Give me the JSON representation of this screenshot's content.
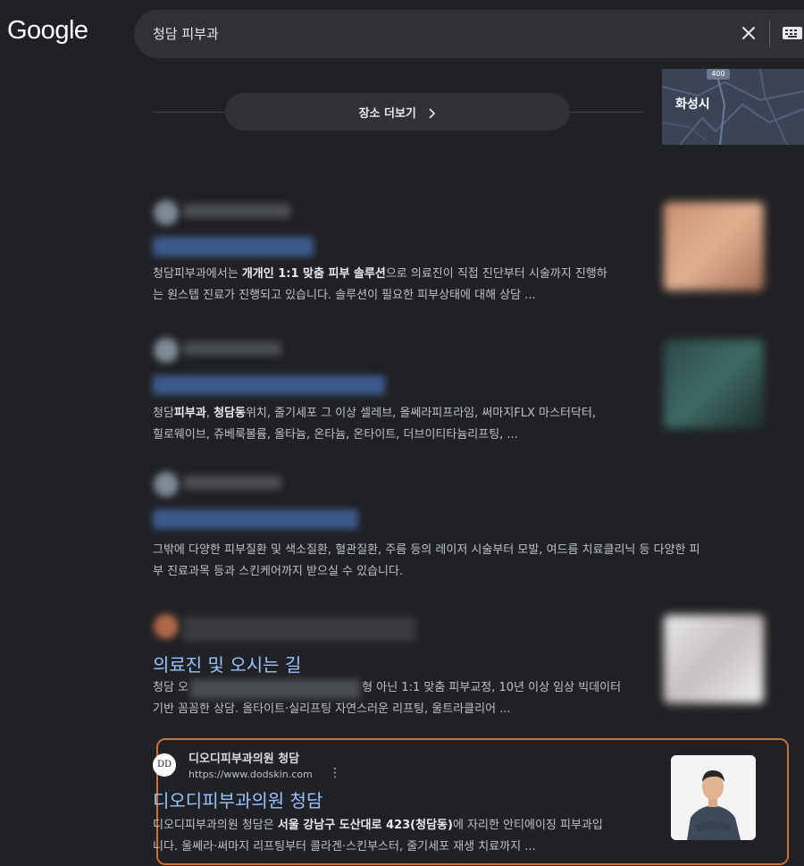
{
  "header": {
    "logo": "Google",
    "query": "청담 피부과",
    "clear_icon": "close-icon",
    "keyboard_icon": "keyboard-icon"
  },
  "places": {
    "more_label": "장소 더보기",
    "chevron_icon": "chevron-right-icon",
    "map_city": "화성시",
    "map_road": "400"
  },
  "results": [
    {
      "snippet_html": "청담피부과에서는 <b>개개인 1:1 맞춤 피부 솔루션</b>으로 의료진이 직접 진단부터 시술까지 진행하<br>는 원스텝 진료가 진행되고 있습니다. 솔루션이 필요한 피부상태에 대해 상담 ..."
    },
    {
      "snippet_html": "청담<b>피부과</b>, <b>청담동</b>위치, 줄기세포 그 이상 셀레브, 올쎄라피프라임, 써마지FLX 마스터닥터,<br>힐로웨이브, 쥬베룩볼륨, 올타늄, 온타늄, 온타이트, 더브이티타늄리프팅, ..."
    },
    {
      "snippet_html": "그밖에 다양한 피부질환 및 색소질환, 혈관질환, 주름 등의 레이저 시술부터 모발, 여드름 치료클리닉 등 다양한 피<br>부 진료과목 등과 스킨케어까지 받으실 수 있습니다."
    },
    {
      "title": "의료진 및 오시는 길",
      "snippet_html": "청담 오 <span style=\"display:inline-block;width:190px\"></span>형 아닌 1:1 맞춤 피부교정</b>, 10년 이상 임상 빅데이터<br>기반 꼼꼼한 상담. 올타이트·실리프팅 자연스러운 리프팅, 울트라클리어 ..."
    },
    {
      "site_name": "디오디피부과의원 청담",
      "url": "https://www.dodskin.com",
      "title": "디오디피부과의원 청담",
      "favicon_text": "DD",
      "more_icon": "more-vert-icon",
      "snippet_html": "디오디피부과의원 청담은 <b>서울 강남구 도산대로 423(청담동)</b>에 자리한 안티에이징 피부과입<br>니다. 울쎄라·써마지 리프팅부터 콜라겐·스킨부스터, 줄기세포 재생 치료까지 ..."
    }
  ]
}
